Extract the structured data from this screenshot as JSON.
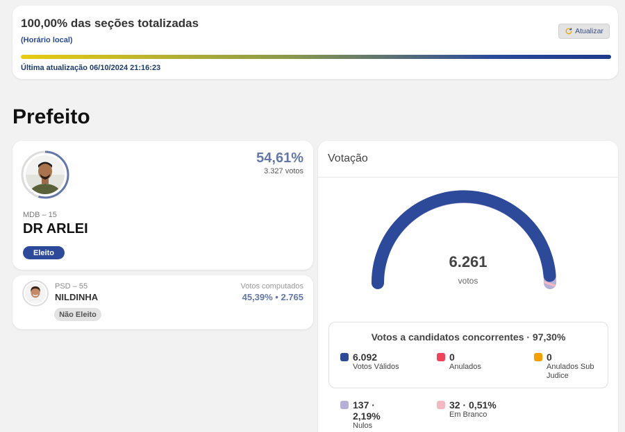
{
  "status": {
    "title": "100,00% das seções totalizadas",
    "subtitle": "(Horário local)",
    "refresh_label": "Atualizar",
    "progress_percent": 100,
    "last_update": "Última atualização 06/10/2024 21:16:23"
  },
  "section_title": "Prefeito",
  "winner": {
    "percent": "54,61%",
    "votes": "3.327 votos",
    "party": "MDB – 15",
    "name": "DR ARLEI",
    "badge": "Eleito",
    "ring_fraction": 0.5461
  },
  "runner_up": {
    "party": "PSD – 55",
    "name": "NILDINHA",
    "computed_label": "Votos computados",
    "computed_value": "45,39% • 2.765",
    "badge": "Não Eleito"
  },
  "votacao": {
    "title": "Votação",
    "total": "6.261",
    "unit": "votos",
    "gauge_fraction_valid": 0.973,
    "concurrent_title": "Votos a candidatos concorrentes · 97,30%",
    "legend": [
      {
        "value": "6.092",
        "label": "Votos Válidos",
        "color": "#2d4a9a"
      },
      {
        "value": "0",
        "label": "Anulados",
        "color": "#f0425a"
      },
      {
        "value": "0",
        "label": "Anulados Sub Judice",
        "color": "#f5a000"
      },
      {
        "value": "137 · 2,19%",
        "label": "Nulos",
        "color": "#b5b0d6"
      },
      {
        "value": "32 · 0,51%",
        "label": "Em Branco",
        "color": "#f5b7c4"
      }
    ]
  },
  "colors": {
    "accent": "#2d4a9a",
    "percent_text": "#6477a8"
  }
}
